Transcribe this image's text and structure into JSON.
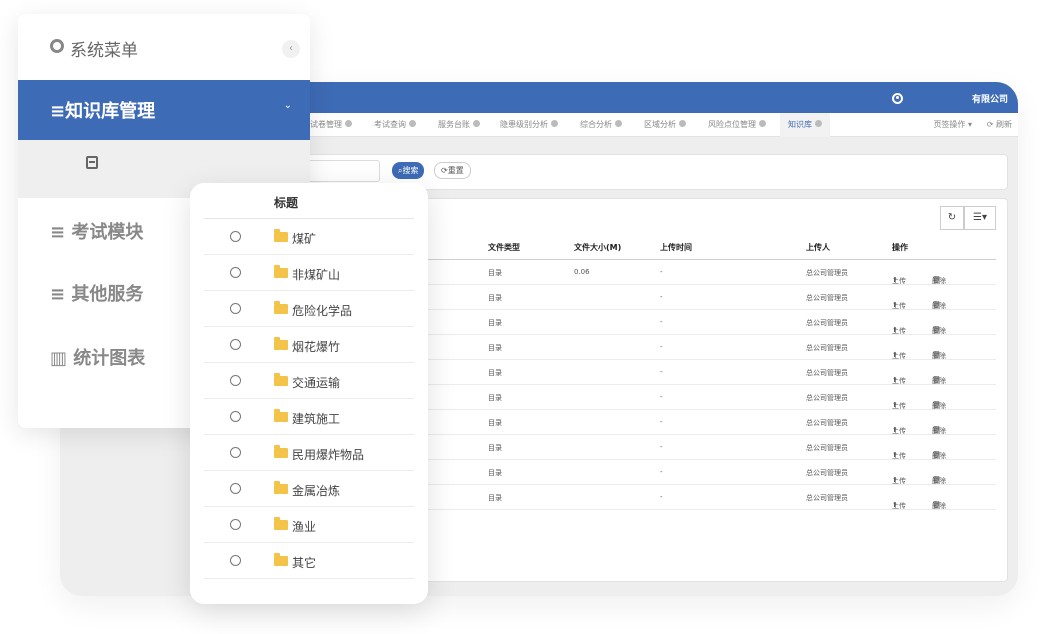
{
  "header": {
    "company": "有限公司"
  },
  "tabs": [
    {
      "label": "试卷管理"
    },
    {
      "label": "考试查询"
    },
    {
      "label": "服务台账"
    },
    {
      "label": "隐患级别分析"
    },
    {
      "label": "综合分析"
    },
    {
      "label": "区域分析"
    },
    {
      "label": "风险点位管理"
    },
    {
      "label": "知识库"
    }
  ],
  "tab_ops": "页签操作 ▾",
  "refresh": "刷新",
  "search": {
    "search_label": "搜索",
    "reset_label": "重置"
  },
  "table": {
    "columns": {
      "file_type": "文件类型",
      "file_size": "文件大小(M)",
      "upload_time": "上传时间",
      "uploader": "上传人",
      "actions": "操作"
    },
    "rows": [
      {
        "type": "目录",
        "size": "0.06",
        "time": "-",
        "uploader": "总公司管理员",
        "upload": "上传",
        "delete": "删除"
      },
      {
        "type": "目录",
        "size": "",
        "time": "-",
        "uploader": "总公司管理员",
        "upload": "上传",
        "delete": "删除"
      },
      {
        "type": "目录",
        "size": "",
        "time": "-",
        "uploader": "总公司管理员",
        "upload": "上传",
        "delete": "删除"
      },
      {
        "type": "目录",
        "size": "",
        "time": "-",
        "uploader": "总公司管理员",
        "upload": "上传",
        "delete": "删除"
      },
      {
        "type": "目录",
        "size": "",
        "time": "-",
        "uploader": "总公司管理员",
        "upload": "上传",
        "delete": "删除"
      },
      {
        "type": "目录",
        "size": "",
        "time": "-",
        "uploader": "总公司管理员",
        "upload": "上传",
        "delete": "删除"
      },
      {
        "type": "目录",
        "size": "",
        "time": "-",
        "uploader": "总公司管理员",
        "upload": "上传",
        "delete": "删除"
      },
      {
        "type": "目录",
        "size": "",
        "time": "-",
        "uploader": "总公司管理员",
        "upload": "上传",
        "delete": "删除"
      },
      {
        "type": "目录",
        "size": "",
        "time": "-",
        "uploader": "总公司管理员",
        "upload": "上传",
        "delete": "删除"
      },
      {
        "type": "目录",
        "size": "",
        "time": "-",
        "uploader": "总公司管理员",
        "upload": "上传",
        "delete": "删除"
      }
    ]
  },
  "sidebar": {
    "title": "系统菜单",
    "active": "知识库管理",
    "items": [
      {
        "label": "考试模块"
      },
      {
        "label": "其他服务"
      },
      {
        "label": "统计图表"
      }
    ]
  },
  "popup": {
    "title": "标题",
    "items": [
      {
        "label": "煤矿"
      },
      {
        "label": "非煤矿山"
      },
      {
        "label": "危险化学品"
      },
      {
        "label": "烟花爆竹"
      },
      {
        "label": "交通运输"
      },
      {
        "label": "建筑施工"
      },
      {
        "label": "民用爆炸物品"
      },
      {
        "label": "金属冶炼"
      },
      {
        "label": "渔业"
      },
      {
        "label": "其它"
      }
    ]
  },
  "colors": {
    "primary": "#3d6bb5",
    "danger": "#e04848",
    "folder": "#f4c34a"
  }
}
